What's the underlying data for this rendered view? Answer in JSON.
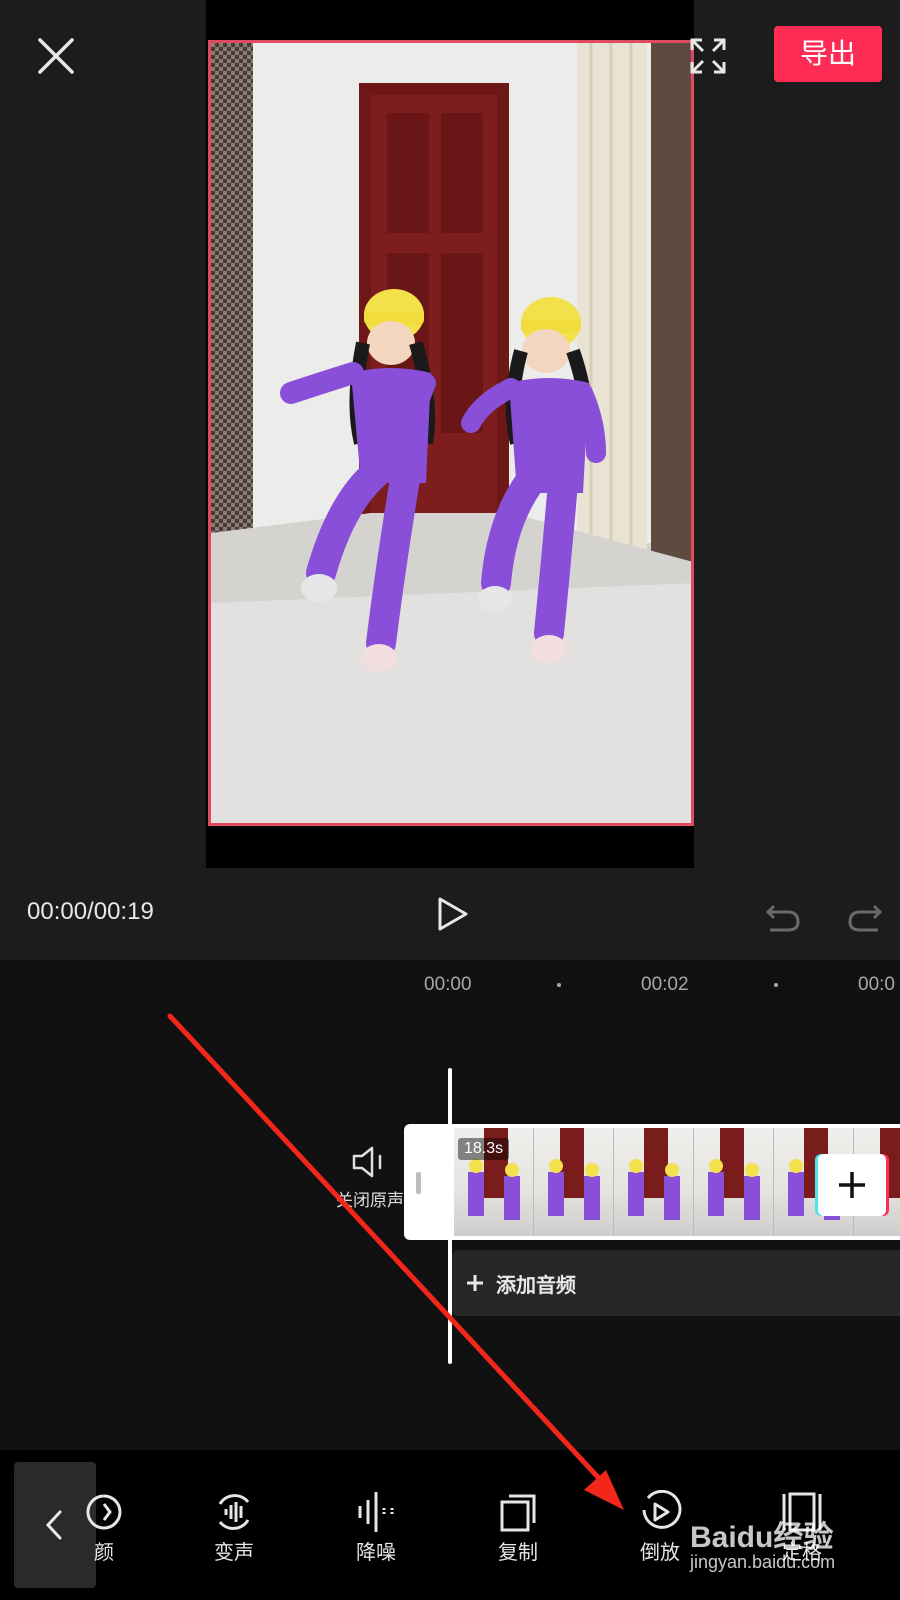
{
  "top_bar": {
    "export_label": "导出",
    "accent_color": "#fe2c55"
  },
  "icons": {
    "close": "close-icon",
    "fullscreen": "fullscreen-icon",
    "play": "play-icon",
    "undo": "undo-icon",
    "redo": "redo-icon",
    "speaker": "speaker-icon",
    "plus": "plus-icon",
    "back": "chevron-left-icon"
  },
  "playback": {
    "time": "00:00/00:19"
  },
  "timeline": {
    "ruler": [
      "00:00",
      "00:02",
      "00:0"
    ],
    "mute_label": "关闭原声",
    "clip_duration": "18.3s",
    "add_audio_label": "添加音频"
  },
  "toolbar": {
    "items": [
      {
        "label": "颜",
        "icon": "color-icon"
      },
      {
        "label": "变声",
        "icon": "voice-change-icon"
      },
      {
        "label": "降噪",
        "icon": "noise-reduction-icon"
      },
      {
        "label": "复制",
        "icon": "copy-icon"
      },
      {
        "label": "倒放",
        "icon": "reverse-icon"
      },
      {
        "label": "定格",
        "icon": "freeze-frame-icon"
      }
    ]
  },
  "watermark": {
    "brand": "Baidu经验",
    "url": "jingyan.baidu.com"
  }
}
